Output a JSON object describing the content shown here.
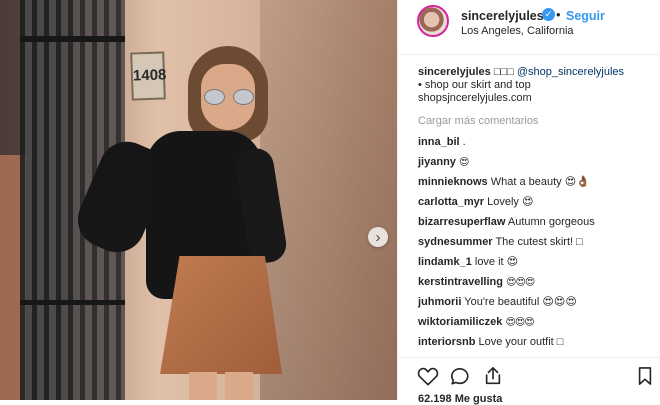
{
  "photo": {
    "address": "1408",
    "next_symbol": "›"
  },
  "post": {
    "username": "sincerelyjules",
    "follow": "Seguir",
    "location": "Los Angeles, California",
    "caption": {
      "username": "sincerelyjules",
      "squares": "□□□",
      "mention": "@shop_sincerelyjules",
      "line2": "• shop our skirt and top",
      "line3": "shopsjncerelyjules.com"
    },
    "load_more": "Cargar más comentarios",
    "comments": [
      {
        "user": "inna_bil",
        "text": "."
      },
      {
        "user": "jiyanny",
        "text": "😍"
      },
      {
        "user": "minnieknows",
        "text": "What a beauty 😍👌🏾"
      },
      {
        "user": "carlotta_myr",
        "text": "Lovely 😍"
      },
      {
        "user": "bizarresuperflaw",
        "text": "Autumn gorgeous"
      },
      {
        "user": "sydnesummer",
        "text": "The cutest skirt! □"
      },
      {
        "user": "lindamk_1",
        "text": "love it 😍"
      },
      {
        "user": "kerstintravelling",
        "text": "😍😍😍"
      },
      {
        "user": "juhmorii",
        "text": "You're beautiful 😍😍😍"
      },
      {
        "user": "wiktoriamiliczek",
        "text": "😍😍😍"
      },
      {
        "user": "interiorsnb",
        "text": "Love your outfit □"
      }
    ],
    "likes": "62.198 Me gusta"
  },
  "icons": {
    "heart": "heart-icon",
    "comment": "comment-icon",
    "share": "share-icon",
    "bookmark": "bookmark-icon",
    "verified": "verified-badge-icon",
    "next": "chevron-right-icon"
  },
  "colors": {
    "instagram_blue": "#3897f0",
    "text": "#262626",
    "muted": "#999999",
    "border": "#efefef",
    "link": "#003569"
  }
}
